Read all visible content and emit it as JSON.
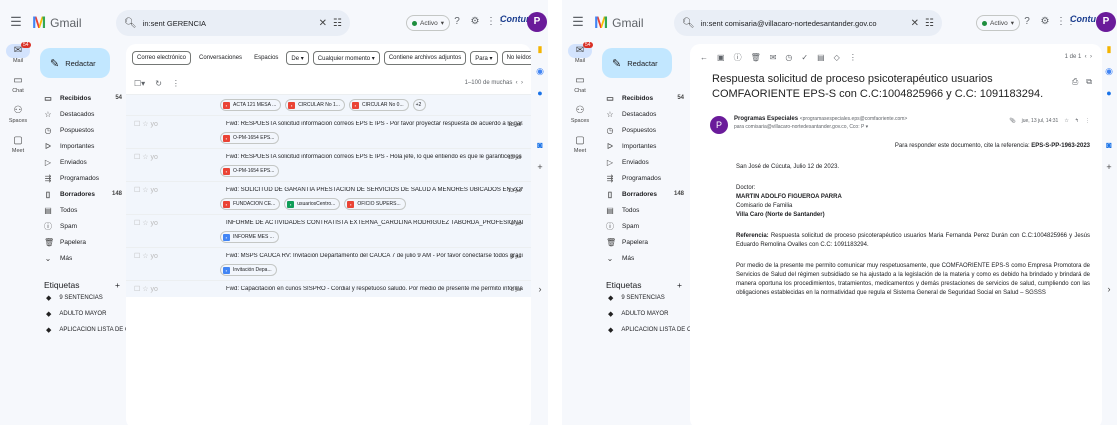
{
  "left": {
    "app": {
      "logo_text": "Gmail"
    },
    "search": {
      "value": "in:sent GERENCIA"
    },
    "status": "Activo",
    "brand": "Contur",
    "avatar": "P",
    "rail": [
      {
        "label": "Mail",
        "icon": "mail-icon",
        "badge": ""
      },
      {
        "label": "Chat",
        "icon": "chat-icon"
      },
      {
        "label": "Spaces",
        "icon": "spaces-icon"
      },
      {
        "label": "Meet",
        "icon": "meet-icon"
      }
    ],
    "compose": "Redactar",
    "nav": [
      {
        "label": "Recibidos",
        "count": "54",
        "icon": "inbox-icon",
        "bold": true
      },
      {
        "label": "Destacados",
        "count": "",
        "icon": "star-icon"
      },
      {
        "label": "Pospuestos",
        "count": "",
        "icon": "clock-icon"
      },
      {
        "label": "Importantes",
        "count": "",
        "icon": "important-icon"
      },
      {
        "label": "Enviados",
        "count": "",
        "icon": "send-icon"
      },
      {
        "label": "Programados",
        "count": "",
        "icon": "scheduled-icon"
      },
      {
        "label": "Borradores",
        "count": "148",
        "icon": "draft-icon",
        "bold": true
      },
      {
        "label": "Todos",
        "count": "",
        "icon": "all-icon"
      },
      {
        "label": "Spam",
        "count": "",
        "icon": "spam-icon"
      },
      {
        "label": "Papelera",
        "count": "",
        "icon": "trash-icon"
      },
      {
        "label": "Más",
        "count": "",
        "icon": "chevron-down-icon"
      }
    ],
    "labels_title": "Etiquetas",
    "labels": [
      "9 SENTENCIAS",
      "ADULTO MAYOR",
      "APLICACION LISTA DE C..."
    ],
    "filters": [
      "Correo electrónico",
      "Conversaciones",
      "Espacios",
      "De ▾",
      "Cualquier momento ▾",
      "Contiene archivos adjuntos",
      "Para ▾",
      "No leídos"
    ],
    "pager": "1–100 de muchas",
    "rows": [
      {
        "from": "",
        "subject": "",
        "date": "",
        "attachments": [
          {
            "name": "ACTA 121 MESA ...",
            "kind": "pdf"
          },
          {
            "name": "CIRCULAR No 1...",
            "kind": "pdf"
          },
          {
            "name": "CIRCULAR No 0...",
            "kind": "pdf"
          },
          {
            "name": "+2",
            "kind": "more"
          }
        ]
      },
      {
        "from": "yo",
        "subject": "Fwd: RESPUESTA solicitud informacion correos EPS E IPS - Por favor proyectar respuesta de acuerdo a la garantía ...",
        "date": "13 jul",
        "attachments": [
          {
            "name": "O-PM-1654 EPS...",
            "kind": "pdf"
          }
        ]
      },
      {
        "from": "yo",
        "subject": "Fwd: RESPUESTA solicitud informacion correos EPS E IPS - Hola jefe, lo que entiendo es que le garanticemos a est...",
        "date": "13 jul",
        "attachments": [
          {
            "name": "O-PM-1654 EPS...",
            "kind": "pdf"
          }
        ]
      },
      {
        "from": "yo",
        "subject": "Fwd: SOLICITUD DE GARANTIA PRESTACION DE SERVICIOS DE SALUD A MENORES UBICADOS EN ZONAS DE DIFI...",
        "date": "13 jul",
        "attachments": [
          {
            "name": "FUNDACION CE...",
            "kind": "pdf"
          },
          {
            "name": "usuariosCentro...",
            "kind": "xls"
          },
          {
            "name": "OFICIO SUPERS...",
            "kind": "pdf"
          }
        ]
      },
      {
        "from": "yo",
        "subject": "INFORME DE ACTIVIDADES CONTRATISTA EXTERNA_CAROLINA RODRIGUEZ TABORDA_PROFESIONAL DE APOYO...",
        "date": "9 jul",
        "attachments": [
          {
            "name": "INFORME MES ...",
            "kind": "doc"
          }
        ]
      },
      {
        "from": "yo",
        "subject": "Fwd: MSPS CAUCA RV: Invitación Departamento del CAUCA 7 de julio 9 AM - Por favor conectarse todos gracias....",
        "date": "6 jul",
        "attachments": [
          {
            "name": "Invitación Depa...",
            "kind": "doc"
          }
        ]
      },
      {
        "from": "yo",
        "subject": "Fwd: Capacitación en cuños SISPRO - Cordial y respetuoso saludo. Por medio de presente me permito informar q...",
        "date": "5 jul",
        "attachments": []
      }
    ]
  },
  "right": {
    "app": {
      "logo_text": "Gmail"
    },
    "search": {
      "value": "in:sent comisaria@villacaro-nortedesantander.gov.co"
    },
    "status": "Activo",
    "brand": "Contur",
    "avatar": "P",
    "compose": "Redactar",
    "pager": "1 de 1",
    "subject": "Respuesta solicitud de proceso psicoterapéutico usuarios COMFAORIENTE EPS-S con C.C:1004825966 y C.C: 1091183294.",
    "sender_name": "Programas Especiales",
    "sender_email": "<programasespeciales.eps@comfaoriente.com>",
    "sender_to": "para comisaria@villacaro-nortedesantander.gov.co, Cco: P ▾",
    "sender_date": "jue, 13 jul, 14:31",
    "body": {
      "ref_line_pre": "Para responder este documento, cite la referencia:",
      "ref_line_code": "EPS-S-PP-1963-2023",
      "place_date": "San José de Cúcuta, Julio 12 de 2023.",
      "salutation": "Doctor:",
      "recipient": "MARTIN ADOLFO FIGUEROA PARRA",
      "role": "Comisario de Familia",
      "city": "Villa Caro (Norte de Santander)",
      "ref_label": "Referencia:",
      "ref_text": "Respuesta solicitud de proceso psicoterapéutico usuarios Maria Fernanda Perez Durán con C.C:1004825966 y Jesús Eduardo Remolina Ovalles con C.C: 1091183294.",
      "paragraph": "Por medio de la presente me permito comunicar muy respetuosamente, que COMFAORIENTE EPS-S como Empresa Promotora de Servicios de Salud del régimen subsidiado se ha ajustado a la legislación de la materia y como es debido ha brindado y brindará de manera oportuna los procedimientos, tratamientos, medicamentos y demás prestaciones de servicios de salud, cumpliendo con las obligaciones establecidas en la normatividad que regula el Sistema General de Seguridad Social en Salud – SGSSS"
    }
  }
}
